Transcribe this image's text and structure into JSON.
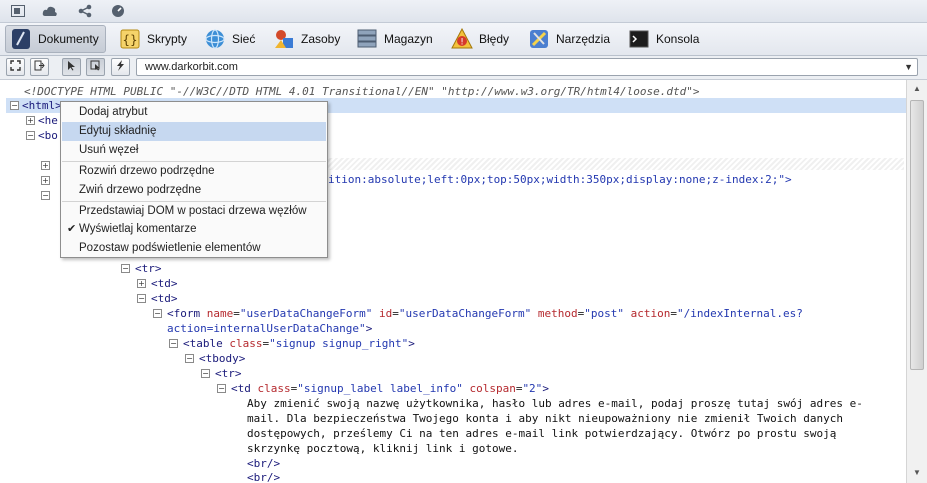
{
  "tabs": [
    {
      "label": "Dokumenty",
      "icon": "dokumenty-icon"
    },
    {
      "label": "Skrypty",
      "icon": "skrypty-icon"
    },
    {
      "label": "Sieć",
      "icon": "siec-icon"
    },
    {
      "label": "Zasoby",
      "icon": "zasoby-icon"
    },
    {
      "label": "Magazyn",
      "icon": "magazyn-icon"
    },
    {
      "label": "Błędy",
      "icon": "bledy-icon"
    },
    {
      "label": "Narzędzia",
      "icon": "narzedzia-icon"
    },
    {
      "label": "Konsola",
      "icon": "konsola-icon"
    }
  ],
  "toolbar": {
    "url": "www.darkorbit.com"
  },
  "tree": {
    "doctype": "<!DOCTYPE HTML PUBLIC \"-//W3C//DTD HTML 4.01 Transitional//EN\" \"http://www.w3.org/TR/html4/loose.dtd\">",
    "html_tag": "<html>",
    "head_fragment": "<he",
    "body_fragment": "<bo",
    "style_fragment": "ition:absolute;left:0px;top:50px;width:350px;display:none;z-index:2;\">",
    "l_tr": "<tr>",
    "l_td1": "<td>",
    "l_td2": "<td>",
    "form_open": "<form",
    "form_name_attr": "name",
    "form_name_val": "\"userDataChangeForm\"",
    "form_id_attr": "id",
    "form_id_val": "\"userDataChangeForm\"",
    "form_method_attr": "method",
    "form_method_val": "\"post\"",
    "form_action_attr": "action",
    "form_action_val": "\"/indexInternal.es?",
    "form_action_val2": "action=internalUserDataChange\"",
    "form_close": ">",
    "table_open": "<table",
    "table_class_attr": "class",
    "table_class_val": "\"signup signup_right\"",
    "table_close": ">",
    "tbody": "<tbody>",
    "tr2": "<tr>",
    "td_open": "<td",
    "td_class_attr": "class",
    "td_class_val": "\"signup_label label_info\"",
    "td_colspan_attr": "colspan",
    "td_colspan_val": "\"2\"",
    "td_close": ">",
    "text1": "Aby zmienić swoją nazwę użytkownika, hasło lub adres e-mail, podaj proszę tutaj swój adres e-",
    "text2": "mail. Dla bezpieczeństwa Twojego konta i aby nikt nieupoważniony nie zmienił Twoich danych",
    "text3": "dostępowych, prześlemy Ci na ten adres e-mail link potwierdzający. Otwórz po prostu swoją",
    "text4": "skrzynkę pocztową, kliknij link i gotowe.",
    "br1": "<br/>",
    "br2": "<br/>"
  },
  "menu": {
    "items": [
      "Dodaj atrybut",
      "Edytuj składnię",
      "Usuń węzeł",
      "Rozwiń drzewo podrzędne",
      "Zwiń drzewo podrzędne",
      "Przedstawiaj DOM w postaci drzewa węzłów",
      "Wyświetlaj komentarze",
      "Pozostaw podświetlenie elementów"
    ],
    "checkmark": "✔"
  },
  "expander": {
    "plus": "+",
    "minus": "−"
  }
}
